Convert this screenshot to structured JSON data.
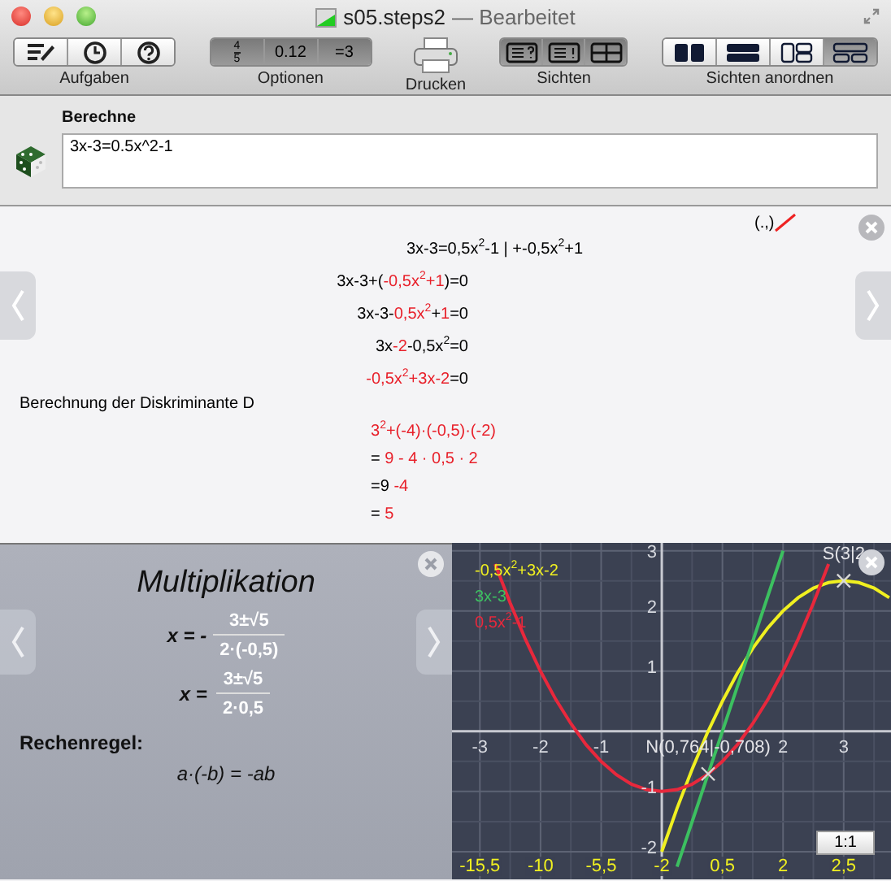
{
  "window": {
    "title": "s05.steps2",
    "status": "— Bearbeitet"
  },
  "toolbar": {
    "groups": [
      {
        "label": "Aufgaben",
        "kind": "icons",
        "items": [
          {
            "selected": false
          },
          {
            "selected": false
          },
          {
            "selected": false
          }
        ]
      },
      {
        "label": "Optionen",
        "kind": "options",
        "items": [
          {
            "kind": "fraction",
            "numerator": "4",
            "denominator": "5",
            "selected": true
          },
          {
            "kind": "text",
            "text": "0.12",
            "selected": true
          },
          {
            "kind": "text",
            "text": "=3",
            "selected": true
          }
        ]
      },
      {
        "label": "Drucken",
        "kind": "print"
      },
      {
        "label": "Sichten",
        "kind": "views",
        "items": [
          {
            "selected": true
          },
          {
            "selected": true
          },
          {
            "selected": true
          }
        ]
      },
      {
        "label": "Sichten anordnen",
        "kind": "arrange",
        "items": [
          {
            "selected": false
          },
          {
            "selected": false
          },
          {
            "selected": false
          },
          {
            "selected": true
          }
        ]
      }
    ]
  },
  "input": {
    "label": "Berechne",
    "value": "3x-3=0.5x^2-1"
  },
  "steps": {
    "decimal_toggle": "(.,)",
    "lines": [
      {
        "kind": "transform",
        "parts": [
          {
            "text": "3x-3=0,5x$^{2}$-1 | +-0,5x$^{2}$+1",
            "red": false
          }
        ]
      },
      {
        "kind": "step",
        "parts": [
          {
            "text": "3x-3+(",
            "red": false
          },
          {
            "text": "-0,5x$^{2}$+1",
            "red": true
          },
          {
            "text": ")=0",
            "red": false
          }
        ]
      },
      {
        "kind": "step",
        "parts": [
          {
            "text": "3x-3-",
            "red": false
          },
          {
            "text": "0,5x$^{2}$",
            "red": true
          },
          {
            "text": "+",
            "red": false
          },
          {
            "text": "1",
            "red": true
          },
          {
            "text": "=0",
            "red": false
          }
        ]
      },
      {
        "kind": "step",
        "parts": [
          {
            "text": "3x",
            "red": false
          },
          {
            "text": "-2",
            "red": true
          },
          {
            "text": "-0,5x$^{2}$=0",
            "red": false
          }
        ]
      },
      {
        "kind": "step",
        "parts": [
          {
            "text": "-0,5x$^{2}$+3x-2",
            "red": true
          },
          {
            "text": "=0",
            "red": false
          }
        ]
      }
    ],
    "heading": "Berechnung der Diskriminante D",
    "discriminant": [
      {
        "parts": [
          {
            "text": "3$^{2}$+(-4)·(-0,5)·(-2)",
            "red": true
          }
        ]
      },
      {
        "parts": [
          {
            "text": "= ",
            "red": false
          },
          {
            "text": "9 - 4 · 0,5 · 2",
            "red": true
          }
        ]
      },
      {
        "parts": [
          {
            "text": "=9 ",
            "red": false
          },
          {
            "text": "-4",
            "red": true
          }
        ]
      },
      {
        "parts": [
          {
            "text": "= ",
            "red": false
          },
          {
            "text": "5",
            "red": true
          }
        ]
      }
    ]
  },
  "hint": {
    "title": "Multiplikation",
    "formulas": [
      {
        "lhs": "x = -",
        "numerator": "3±√5",
        "denominator": "2·(-0,5)"
      },
      {
        "lhs": "x =",
        "numerator": "3±√5",
        "denominator": "2·0,5"
      }
    ],
    "rule_label": "Rechenregel:",
    "rule": "a·(-b) = -ab"
  },
  "graph": {
    "scale_button": "1:1",
    "x_value_labels": [
      "-15,5",
      "-10",
      "-5,5",
      "-2",
      "0,5",
      "2",
      "2,5"
    ],
    "chart_data": {
      "type": "line",
      "grid": true,
      "x": [
        -2.75,
        -2.5,
        -2.25,
        -2,
        -1.75,
        -1.5,
        -1.25,
        -1,
        -0.75,
        -0.5,
        -0.25,
        0,
        0.25,
        0.5,
        0.75,
        1,
        1.25,
        1.5,
        1.75,
        2,
        2.25,
        2.5,
        2.75,
        3,
        3.25,
        3.5,
        3.75
      ],
      "series": [
        {
          "name": "-0,5x$^{2}$+3x-2",
          "color": "#f0f020",
          "values": [
            null,
            null,
            null,
            null,
            null,
            null,
            null,
            null,
            null,
            null,
            null,
            -2,
            -1.28,
            -0.63,
            -0.03,
            0.5,
            0.97,
            1.38,
            1.72,
            2,
            2.22,
            2.38,
            2.47,
            2.5,
            2.47,
            2.38,
            2.22
          ]
        },
        {
          "name": "3x-3",
          "color": "#3cc060",
          "values": [
            null,
            null,
            null,
            null,
            null,
            null,
            null,
            null,
            null,
            null,
            null,
            null,
            -2.25,
            -1.5,
            -0.75,
            0,
            0.75,
            1.5,
            2.25,
            3,
            null,
            null,
            null,
            null,
            null,
            null,
            null
          ]
        },
        {
          "name": "0,5x$^{2}$-1",
          "color": "#e8283c",
          "values": [
            2.78,
            2.13,
            1.53,
            1,
            0.53,
            0.13,
            -0.22,
            -0.5,
            -0.72,
            -0.88,
            -0.97,
            -1,
            -0.97,
            -0.88,
            -0.72,
            -0.5,
            -0.22,
            0.13,
            0.53,
            1,
            1.53,
            2.13,
            2.78,
            null,
            null,
            null,
            null
          ]
        }
      ],
      "xlim": [
        -3.46,
        3.78
      ],
      "ylim": [
        -2.46,
        3.13
      ],
      "xticks": [
        -3,
        -2,
        -1,
        2,
        3
      ],
      "yticks": [
        -2,
        -1,
        1,
        2,
        3
      ],
      "annotations": [
        {
          "text": "N(0,764|-0,708)",
          "x": 0.764,
          "y": -0.708
        },
        {
          "text": "S(3|2",
          "x": 3,
          "y": 2.5
        }
      ]
    }
  }
}
